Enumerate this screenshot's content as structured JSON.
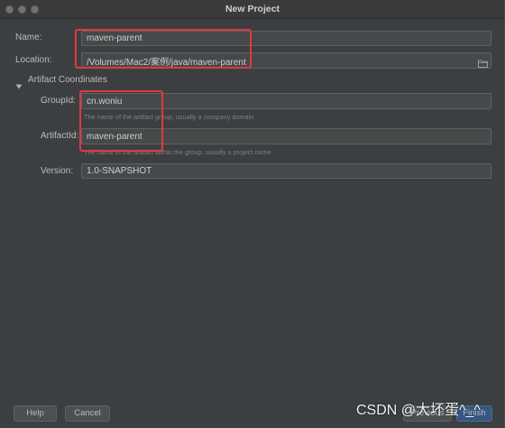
{
  "window": {
    "title": "New Project",
    "controls": [
      "close-icon",
      "minimize-icon",
      "zoom-icon"
    ]
  },
  "form": {
    "name": {
      "label": "Name:",
      "value": "maven-parent"
    },
    "location": {
      "label": "Location:",
      "value": "/Volumes/Mac2/案例/java/maven-parent",
      "icon": "folder-icon"
    },
    "artifact_coordinates": {
      "title": "Artifact Coordinates",
      "expanded": true,
      "toggle_icon": "triangle-down-icon",
      "group_id": {
        "label": "GroupId:",
        "value": "cn.woniu",
        "hint": "The name of the artifact group, usually a company domain"
      },
      "artifact_id": {
        "label": "ArtifactId:",
        "value": "maven-parent",
        "hint": "The name of the artifact within the group, usually a project name"
      },
      "version": {
        "label": "Version:",
        "value": "1.0-SNAPSHOT"
      }
    }
  },
  "footer": {
    "help": "Help",
    "cancel": "Cancel",
    "previous": "Previous",
    "finish": "Finish"
  },
  "watermark": "CSDN @大坏蛋^_^",
  "colors": {
    "background": "#3c3f41",
    "field": "#45494a",
    "text": "#bbbbbb",
    "hint": "#7f7f7f",
    "primary_button": "#365880",
    "annotation": "#e0393e"
  }
}
